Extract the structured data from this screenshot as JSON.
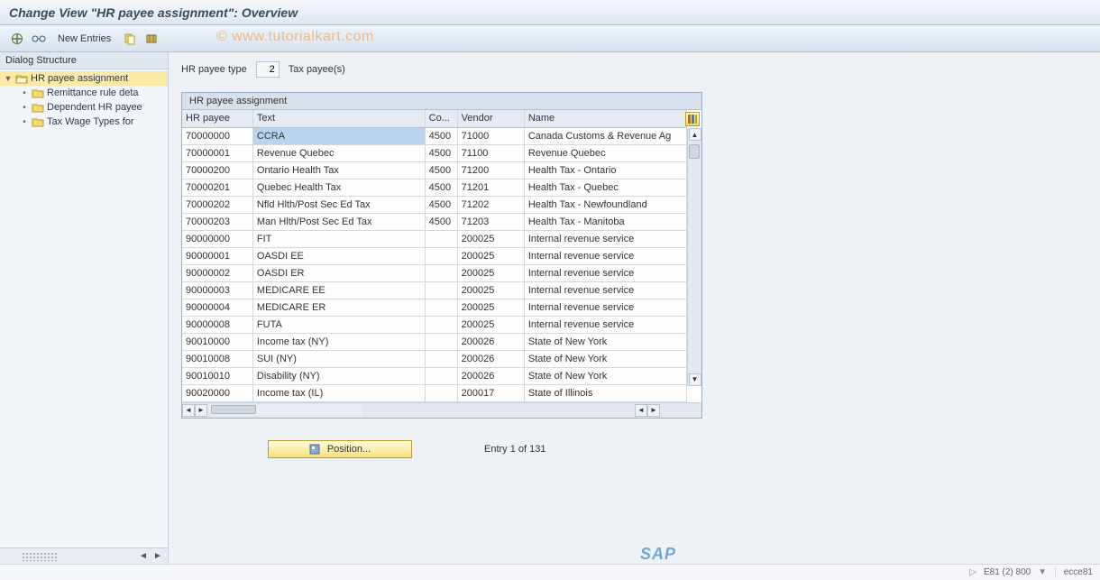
{
  "title": "Change View \"HR payee assignment\": Overview",
  "watermark": "© www.tutorialkart.com",
  "toolbar": {
    "new_entries": "New Entries"
  },
  "left_panel": {
    "header": "Dialog Structure",
    "tree": [
      {
        "label": "HR payee assignment",
        "level": 0,
        "expanded": true,
        "selected": true,
        "open_folder": true
      },
      {
        "label": "Remittance rule deta",
        "level": 1
      },
      {
        "label": "Dependent HR payee",
        "level": 1
      },
      {
        "label": "Tax Wage Types for",
        "level": 1
      }
    ]
  },
  "header_fields": {
    "type_label": "HR payee type",
    "type_value": "2",
    "type_desc": "Tax payee(s)"
  },
  "grid": {
    "title": "HR payee assignment",
    "columns": [
      "HR payee",
      "Text",
      "Co...",
      "Vendor",
      "Name"
    ],
    "rows": [
      {
        "hr": "70000000",
        "text": "CCRA",
        "co": "4500",
        "vendor": "71000",
        "name": "Canada Customs & Revenue Ag",
        "sel": true
      },
      {
        "hr": "70000001",
        "text": "Revenue Quebec",
        "co": "4500",
        "vendor": "71100",
        "name": "Revenue Quebec"
      },
      {
        "hr": "70000200",
        "text": "Ontario Health Tax",
        "co": "4500",
        "vendor": "71200",
        "name": "Health Tax - Ontario"
      },
      {
        "hr": "70000201",
        "text": "Quebec Health Tax",
        "co": "4500",
        "vendor": "71201",
        "name": "Health Tax - Quebec"
      },
      {
        "hr": "70000202",
        "text": "Nfld Hlth/Post Sec Ed Tax",
        "co": "4500",
        "vendor": "71202",
        "name": "Health Tax - Newfoundland"
      },
      {
        "hr": "70000203",
        "text": "Man Hlth/Post Sec Ed Tax",
        "co": "4500",
        "vendor": "71203",
        "name": "Health Tax - Manitoba"
      },
      {
        "hr": "90000000",
        "text": "FIT",
        "co": "",
        "vendor": "200025",
        "name": "Internal revenue service"
      },
      {
        "hr": "90000001",
        "text": "OASDI    EE",
        "co": "",
        "vendor": "200025",
        "name": "Internal revenue service"
      },
      {
        "hr": "90000002",
        "text": "OASDI    ER",
        "co": "",
        "vendor": "200025",
        "name": "Internal revenue service"
      },
      {
        "hr": "90000003",
        "text": "MEDICARE EE",
        "co": "",
        "vendor": "200025",
        "name": "Internal revenue service"
      },
      {
        "hr": "90000004",
        "text": "MEDICARE ER",
        "co": "",
        "vendor": "200025",
        "name": "Internal revenue service"
      },
      {
        "hr": "90000008",
        "text": "FUTA",
        "co": "",
        "vendor": "200025",
        "name": "Internal revenue service"
      },
      {
        "hr": "90010000",
        "text": "Income tax (NY)",
        "co": "",
        "vendor": "200026",
        "name": "State of New York"
      },
      {
        "hr": "90010008",
        "text": "SUI       (NY)",
        "co": "",
        "vendor": "200026",
        "name": "State of New York"
      },
      {
        "hr": "90010010",
        "text": "Disability (NY)",
        "co": "",
        "vendor": "200026",
        "name": "State of New York"
      },
      {
        "hr": "90020000",
        "text": "Income tax (IL)",
        "co": "",
        "vendor": "200017",
        "name": "State of Illinois"
      }
    ]
  },
  "footer": {
    "position_btn": "Position...",
    "entry_label": "Entry 1 of 131"
  },
  "status_bar": {
    "sys1": "E81 (2) 800",
    "sys2": "ecce81"
  },
  "sap_logo": "SAP"
}
